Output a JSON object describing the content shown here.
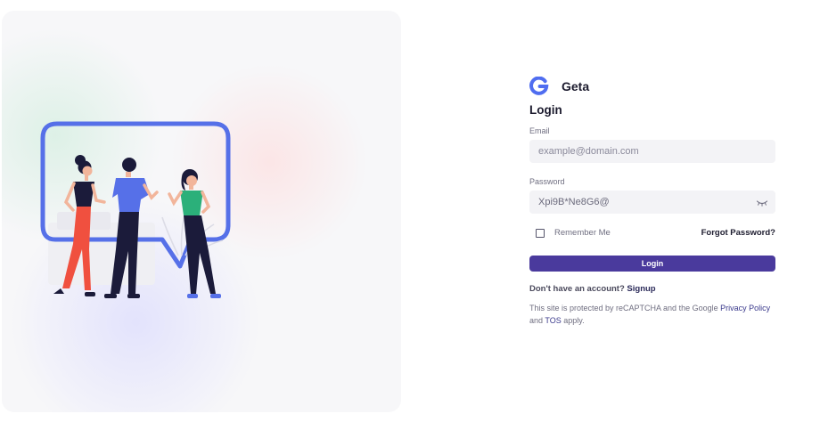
{
  "brand": {
    "name": "Geta",
    "logo_icon": "g-logo-icon",
    "accent": "#4f6df0"
  },
  "login": {
    "title": "Login",
    "email_label": "Email",
    "email_placeholder": "example@domain.com",
    "password_label": "Password",
    "password_value": "Xpi9B*Ne8G6@",
    "password_icon": "eye-closed-icon",
    "remember_label": "Remember Me",
    "remember_checked": false,
    "forgot_label": "Forgot Password?",
    "login_button": "Login",
    "signup_prompt": "Don't have an account?",
    "signup_link": "Signup",
    "recaptcha_prefix": "This site is protected by reCAPTCHA and the Google",
    "privacy_link": "Privacy Policy",
    "and_text": "and",
    "tos_link": "TOS",
    "apply_text": "apply."
  },
  "colors": {
    "button": "#4a3a9d",
    "input_bg": "#f3f3f6",
    "bubble": "#5670e8"
  }
}
